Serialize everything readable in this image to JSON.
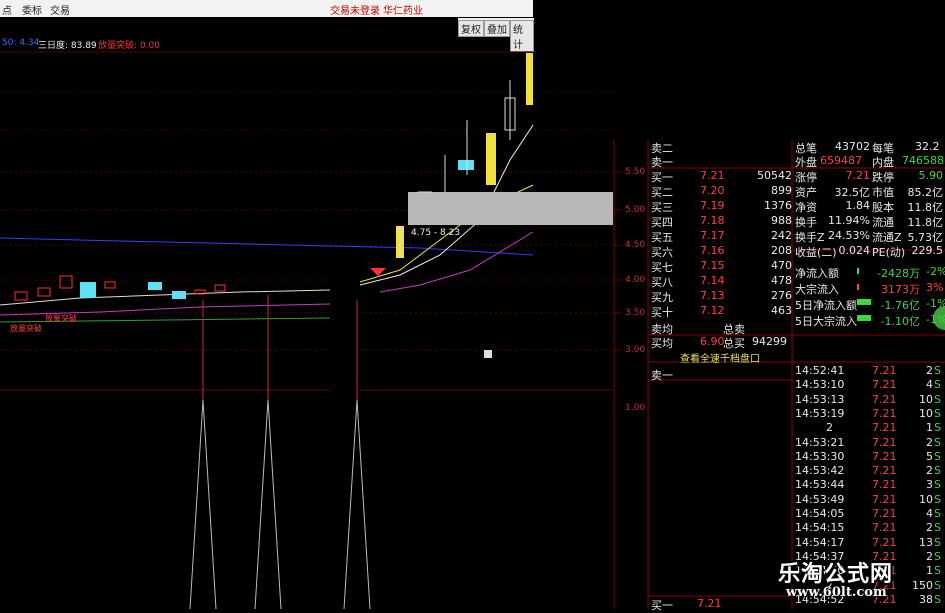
{
  "topbar": {
    "left_items": [
      "点",
      "委标",
      "交易"
    ],
    "login_text": "交易未登录",
    "broker": "华仁药业"
  },
  "toolbar": {
    "buttons": [
      "复权",
      "叠加",
      "统计"
    ]
  },
  "indicators": {
    "lead": "50: 4.34",
    "name": "三日度: 83.89",
    "second": "放量突破: 0.00"
  },
  "price_axis": [
    "5.50",
    "5.00",
    "4.50",
    "4.00",
    "3.50",
    "3.00",
    "1.00"
  ],
  "range_label": "4.75 - 8.23",
  "chart_annotations": [
    "放量突破",
    "放量突破"
  ],
  "summary": {
    "row0": [
      "总笔",
      "43702",
      "每笔",
      "32.2"
    ],
    "row1": [
      "外盘",
      "659487",
      "内盘",
      "746588"
    ],
    "cols_left": [
      "涨停",
      "资产",
      "净资",
      "换手",
      "换手Z",
      "收益(二)"
    ],
    "vals_left": [
      "7.21",
      "32.5亿",
      "1.84",
      "11.94%",
      "24.53%",
      "0.024"
    ],
    "cols_right": [
      "跌停",
      "市值",
      "股本",
      "流通",
      "流通Z",
      "PE(动)"
    ],
    "vals_right": [
      "5.90",
      "85.2亿",
      "11.8亿",
      "11.8亿",
      "5.73亿",
      "229.5"
    ],
    "flows": [
      {
        "label": "净流入额",
        "value": "-2428万",
        "pct": "-2%"
      },
      {
        "label": "大宗流入",
        "value": "3173万",
        "pct": "3%"
      },
      {
        "label": "5日净流入额",
        "value": "-1.76亿",
        "pct": "-1%"
      },
      {
        "label": "5日大宗流入",
        "value": "-1.10亿",
        "pct": "-1%"
      }
    ]
  },
  "orderbook": {
    "top_labels": [
      "卖二",
      "卖一"
    ],
    "buys": [
      {
        "label": "买一",
        "price": "7.21",
        "vol": "50542"
      },
      {
        "label": "买二",
        "price": "7.20",
        "vol": "899"
      },
      {
        "label": "买三",
        "price": "7.19",
        "vol": "1376"
      },
      {
        "label": "买四",
        "price": "7.18",
        "vol": "988"
      },
      {
        "label": "买五",
        "price": "7.17",
        "vol": "242"
      },
      {
        "label": "买六",
        "price": "7.16",
        "vol": "208"
      },
      {
        "label": "买七",
        "price": "7.15",
        "vol": "470"
      },
      {
        "label": "买八",
        "price": "7.14",
        "vol": "478"
      },
      {
        "label": "买九",
        "price": "7.13",
        "vol": "276"
      },
      {
        "label": "买十",
        "price": "7.12",
        "vol": "463"
      }
    ],
    "sell_avg": "卖均",
    "total_sell": "总卖",
    "buy_avg": "买均",
    "buy_avg_price": "6.90",
    "total_buy": "总买",
    "total_buy_vol": "94299",
    "link": "查看全速千档盘口",
    "sell1": "卖一",
    "bottom_label": "买一",
    "bottom_price": "7.21"
  },
  "ticks": [
    {
      "time": "14:52:41",
      "price": "7.21",
      "vol": "2",
      "side": "S"
    },
    {
      "time": "14:53:10",
      "price": "7.21",
      "vol": "4",
      "side": "S"
    },
    {
      "time": "14:53:13",
      "price": "7.21",
      "vol": "10",
      "side": "S"
    },
    {
      "time": "14:53:19",
      "price": "7.21",
      "vol": "10",
      "side": "S"
    },
    {
      "time": "2",
      "price": "7.21",
      "vol": "1",
      "side": "S"
    },
    {
      "time": "14:53:21",
      "price": "7.21",
      "vol": "2",
      "side": "S"
    },
    {
      "time": "14:53:30",
      "price": "7.21",
      "vol": "5",
      "side": "S"
    },
    {
      "time": "14:53:42",
      "price": "7.21",
      "vol": "2",
      "side": "S"
    },
    {
      "time": "14:53:44",
      "price": "7.21",
      "vol": "3",
      "side": "S"
    },
    {
      "time": "14:53:49",
      "price": "7.21",
      "vol": "10",
      "side": "S"
    },
    {
      "time": "14:54:05",
      "price": "7.21",
      "vol": "4",
      "side": "S"
    },
    {
      "time": "14:54:15",
      "price": "7.21",
      "vol": "2",
      "side": "S"
    },
    {
      "time": "14:54:17",
      "price": "7.21",
      "vol": "13",
      "side": "S"
    },
    {
      "time": "14:54:37",
      "price": "7.21",
      "vol": "2",
      "side": "S"
    },
    {
      "time": "14:54:50",
      "price": "7.21",
      "vol": "1",
      "side": "S"
    },
    {
      "time": "2",
      "price": "7.21",
      "vol": "150",
      "side": "S"
    },
    {
      "time": "14:54:52",
      "price": "7.21",
      "vol": "38",
      "side": "S"
    }
  ],
  "watermark": {
    "title": "乐淘公式网",
    "url": "www.60lt.com"
  }
}
